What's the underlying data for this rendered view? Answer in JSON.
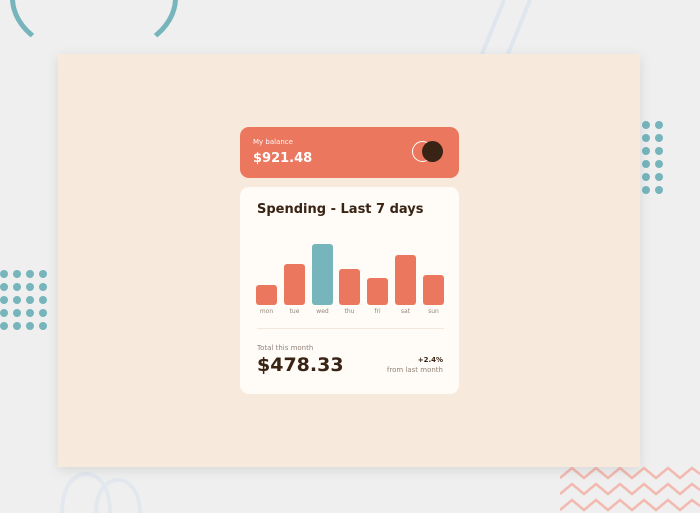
{
  "balance": {
    "label": "My balance",
    "amount": "$921.48",
    "logo_icon": "two-circles-logo-icon"
  },
  "spending": {
    "title": "Spending - Last 7 days",
    "total_label": "Total this month",
    "total_value": "$478.33",
    "change_pct": "+2.4%",
    "change_label": "from last month"
  },
  "colors": {
    "background": "#efefef",
    "frame": "#f8e9dd",
    "card": "#fffbf6",
    "accent": "#ec775f",
    "highlight": "#76b5bc",
    "dark": "#382314",
    "muted": "#93867b"
  },
  "chart_data": {
    "type": "bar",
    "categories": [
      "mon",
      "tue",
      "wed",
      "thu",
      "fri",
      "sat",
      "sun"
    ],
    "values": [
      17.45,
      34.91,
      52.36,
      31.07,
      23.39,
      43.28,
      25.48
    ],
    "highlight_index": 2,
    "xlabel": "",
    "ylabel": "",
    "ylim": [
      0,
      52.36
    ],
    "grid": false
  }
}
